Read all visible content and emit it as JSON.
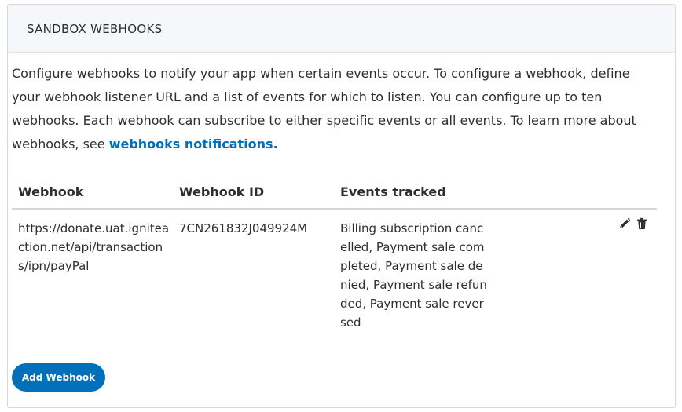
{
  "panel": {
    "title": "SANDBOX WEBHOOKS",
    "description": "Configure webhooks to notify your app when certain events occur. To configure a webhook, define your webhook listener URL and a list of events for which to listen. You can configure up to ten webhooks. Each webhook can subscribe to either specific events or all events. To learn more about webhooks, see ",
    "link_text": "webhooks notifications."
  },
  "table": {
    "headers": [
      "Webhook",
      "Webhook ID",
      "Events tracked"
    ],
    "rows": [
      {
        "url": "https://donate.uat.igniteaction.net/api/transactions/ipn/payPal",
        "id": "7CN261832J049924M",
        "events": "Billing subscription cancelled, Payment sale completed, Payment sale denied, Payment sale refunded, Payment sale reversed",
        "icons": [
          "pencil-icon",
          "trash-icon"
        ]
      }
    ]
  },
  "actions": {
    "add_label": "Add Webhook"
  },
  "colors": {
    "accent": "#0070ba",
    "header_bg": "#f5f7fa"
  }
}
